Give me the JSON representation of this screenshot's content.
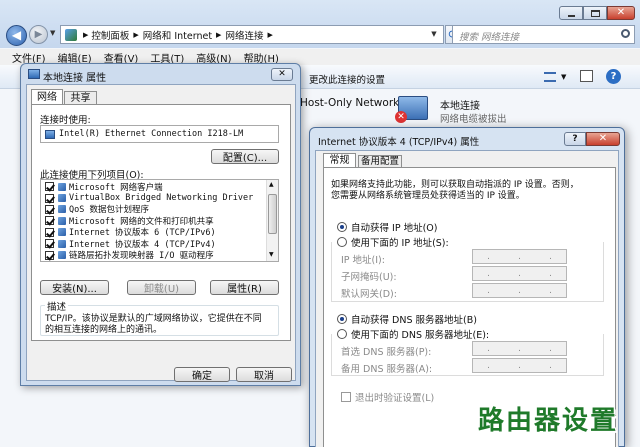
{
  "explorer": {
    "breadcrumb": [
      "控制面板",
      "网络和 Internet",
      "网络连接"
    ],
    "search_placeholder": "搜索 网络连接",
    "menu": [
      "文件(F)",
      "编辑(E)",
      "查看(V)",
      "工具(T)",
      "高级(N)",
      "帮助(H)"
    ],
    "toolbar_item": "更改此连接的设置",
    "host_only_label": "Host-Only Network",
    "local_conn_name": "本地连接",
    "local_conn_status": "网络电缆被拔出"
  },
  "props": {
    "title": "本地连接 属性",
    "tabs": [
      "网络",
      "共享"
    ],
    "connect_using_label": "连接时使用:",
    "adapter": "Intel(R) Ethernet Connection I218-LM",
    "configure_btn": "配置(C)...",
    "items_label": "此连接使用下列项目(O):",
    "items": [
      {
        "label": "Microsoft 网络客户端",
        "checked": true
      },
      {
        "label": "VirtualBox Bridged Networking Driver",
        "checked": true
      },
      {
        "label": "QoS 数据包计划程序",
        "checked": true
      },
      {
        "label": "Microsoft 网络的文件和打印机共享",
        "checked": true
      },
      {
        "label": "Internet 协议版本 6 (TCP/IPv6)",
        "checked": true
      },
      {
        "label": "Internet 协议版本 4 (TCP/IPv4)",
        "checked": true
      },
      {
        "label": "链路层拓扑发现映射器 I/O 驱动程序",
        "checked": true
      }
    ],
    "install_btn": "安装(N)...",
    "uninstall_btn": "卸载(U)",
    "properties_btn": "属性(R)",
    "desc_group": "描述",
    "desc_text_1": "TCP/IP。该协议是默认的广域网络协议，它提供在不同",
    "desc_text_2": "的相互连接的网络上的通讯。",
    "ok_btn": "确定",
    "cancel_btn": "取消"
  },
  "ipv4": {
    "title": "Internet 协议版本 4 (TCP/IPv4) 属性",
    "help": "?",
    "tabs": [
      "常规",
      "备用配置"
    ],
    "intro_1": "如果网络支持此功能，则可以获取自动指派的 IP 设置。否则，",
    "intro_2": "您需要从网络系统管理员处获得适当的 IP 设置。",
    "auto_ip": "自动获得 IP 地址(O)",
    "manual_ip": "使用下面的 IP 地址(S):",
    "ip_label": "IP 地址(I):",
    "mask_label": "子网掩码(U):",
    "gateway_label": "默认网关(D):",
    "auto_dns": "自动获得 DNS 服务器地址(B)",
    "manual_dns": "使用下面的 DNS 服务器地址(E):",
    "dns1_label": "首选 DNS 服务器(P):",
    "dns2_label": "备用 DNS 服务器(A):",
    "validate_label": "退出时验证设置(L)"
  },
  "watermark": "路由器设置"
}
